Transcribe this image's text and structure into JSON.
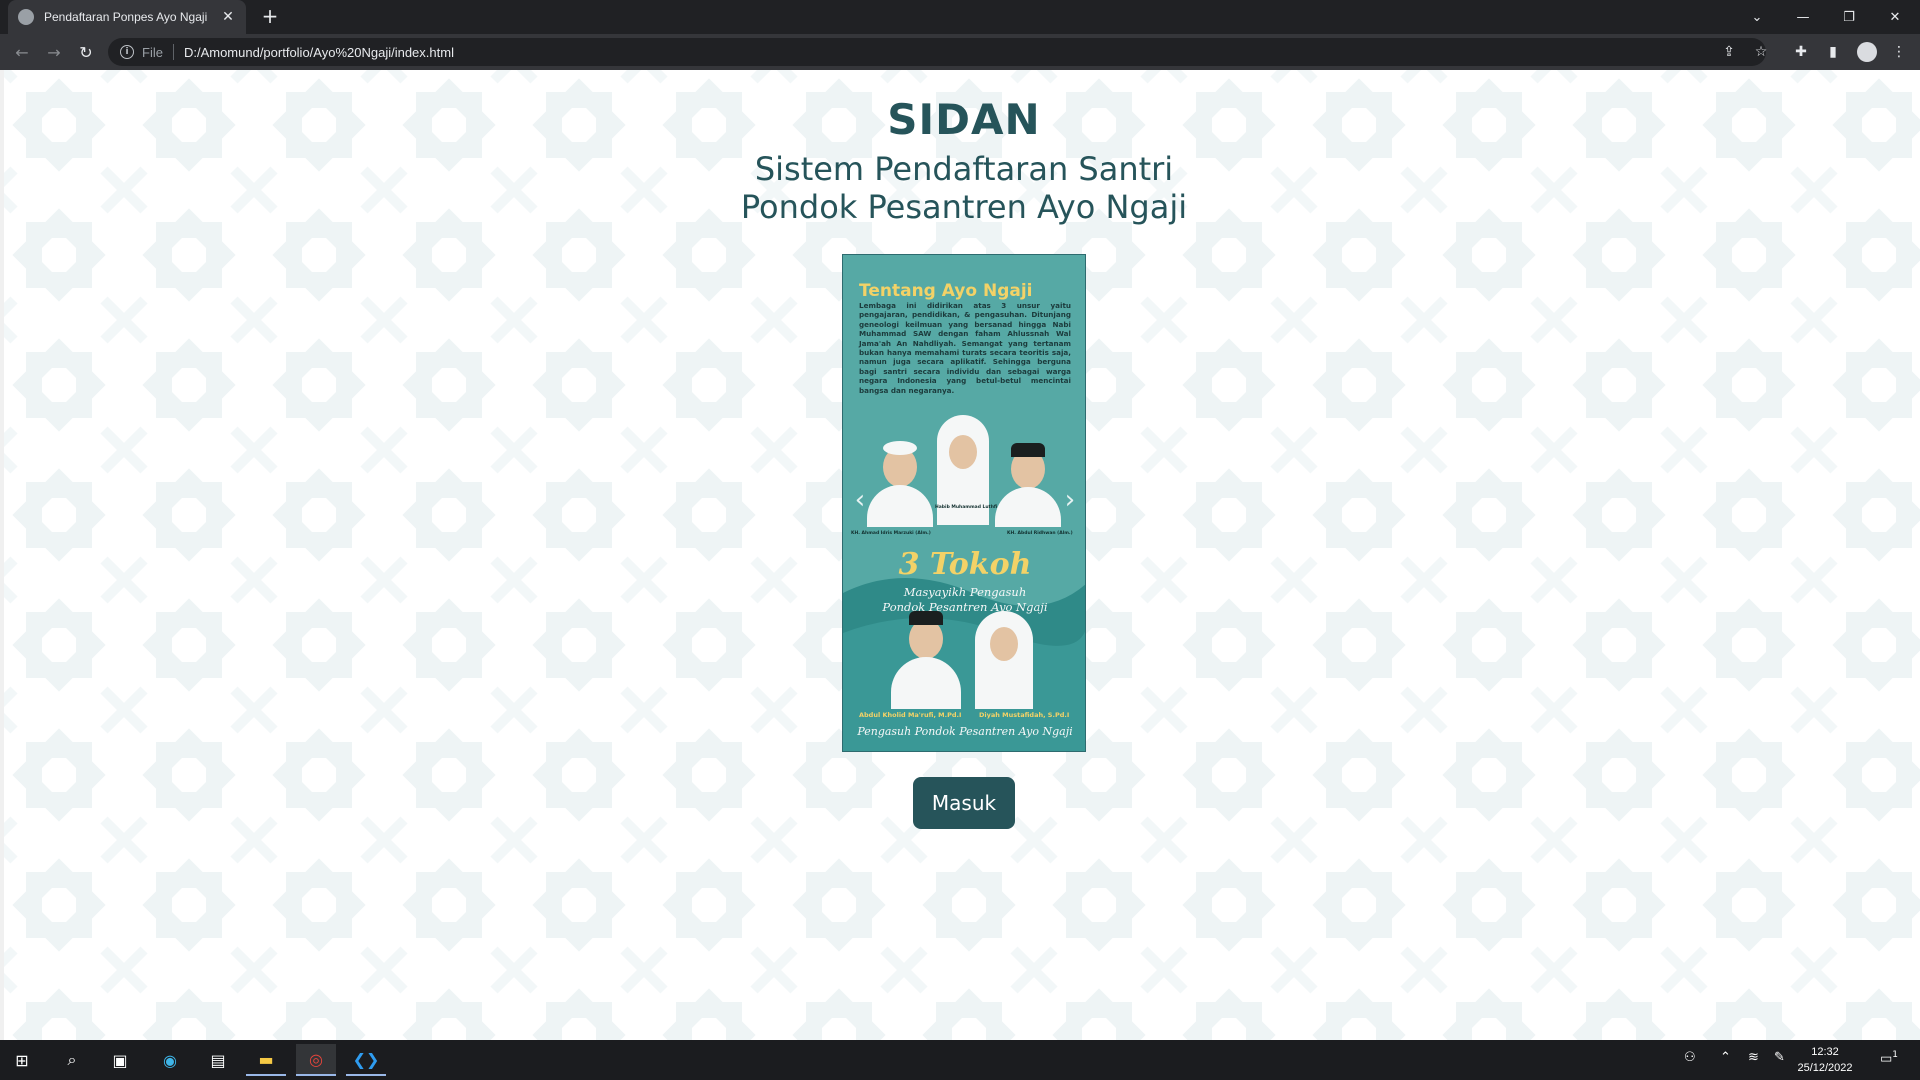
{
  "browser": {
    "tab_title": "Pendaftaran Ponpes Ayo Ngaji",
    "tab_close": "✕",
    "new_tab": "+",
    "url_scheme": "File",
    "url": "D:/Amomund/portfolio/Ayo%20Ngaji/index.html"
  },
  "page": {
    "brand": "SIDAN",
    "subtitle_line1": "Sistem Pendaftaran Santri",
    "subtitle_line2": "Pondok Pesantren Ayo Ngaji",
    "login_button": "Masuk",
    "pattern_color": "#eef4f5",
    "accent_color": "#26545a"
  },
  "poster": {
    "title": "Tentang Ayo Ngaji",
    "text": "Lembaga ini didirikan atas 3 unsur yaitu pengajaran, pendidikan, & pengasuhan. Ditunjang geneologi keilmuan yang bersanad hingga Nabi Muhammad SAW dengan faham Ahlussnah Wal Jama'ah An Nahdliyah. Semangat yang tertanam bukan hanya memahami turats secara teoritis saja, namun juga secara aplikatif. Sehingga berguna bagi santri secara individu dan sebagai warga negara Indonesia yang betul-betul mencintai bangsa dan negaranya.",
    "caption_left": "KH. Ahmad Idris Marzuki (Alm.)",
    "caption_center": "Habib Muhammad Luthfi",
    "caption_right": "KH. Abdul Ridhwan (Alm.)",
    "tokoh_title": "3 Tokoh",
    "tokoh_sub1": "Masyayikh Pengasuh",
    "tokoh_sub2": "Pondok Pesantren Ayo Ngaji",
    "bottom_left": "Abdul Kholid Ma'rufi, M.Pd.I",
    "bottom_right": "Diyah Mustafidah, S.Pd.I",
    "bottom_title": "Pengasuh Pondok Pesantren Ayo Ngaji",
    "arrow_prev": "‹",
    "arrow_next": "›"
  },
  "taskbar": {
    "time": "12:32",
    "date": "25/12/2022",
    "notification_count": "1"
  }
}
